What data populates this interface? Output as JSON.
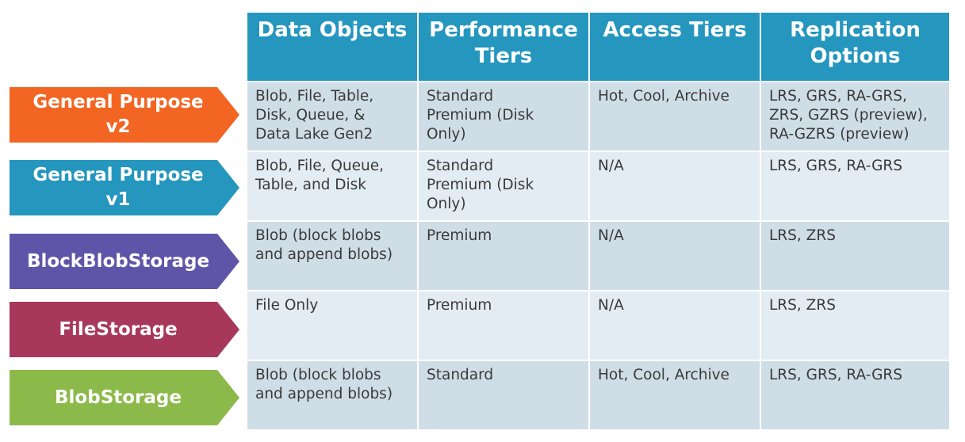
{
  "headers": [
    "Data Objects",
    "Performance\nTiers",
    "Access Tiers",
    "Replication\nOptions"
  ],
  "rows": [
    {
      "label": "General Purpose\nv2",
      "color": "#f26522",
      "cells": [
        "Blob, File, Table,\nDisk, Queue, &\nData Lake Gen2",
        "Standard\nPremium (Disk\nOnly)",
        "Hot, Cool, Archive",
        "LRS, GRS, RA-GRS,\nZRS, GZRS (preview),\nRA-GZRS (preview)"
      ]
    },
    {
      "label": "General Purpose\nv1",
      "color": "#2596be",
      "cells": [
        "Blob, File, Queue,\nTable, and Disk",
        "Standard\nPremium (Disk\nOnly)",
        "N/A",
        "LRS, GRS, RA-GRS"
      ]
    },
    {
      "label": "BlockBlobStorage",
      "color": "#5f55a8",
      "cells": [
        "Blob (block blobs\nand append blobs)",
        "Premium",
        "N/A",
        "LRS, ZRS"
      ]
    },
    {
      "label": "FileStorage",
      "color": "#a8385b",
      "cells": [
        "File Only",
        "Premium",
        "N/A",
        "LRS, ZRS"
      ]
    },
    {
      "label": "BlobStorage",
      "color": "#8cba4a",
      "cells": [
        "Blob (block blobs\nand append blobs)",
        "Standard",
        "Hot, Cool, Archive",
        "LRS, GRS, RA-GRS"
      ]
    }
  ]
}
